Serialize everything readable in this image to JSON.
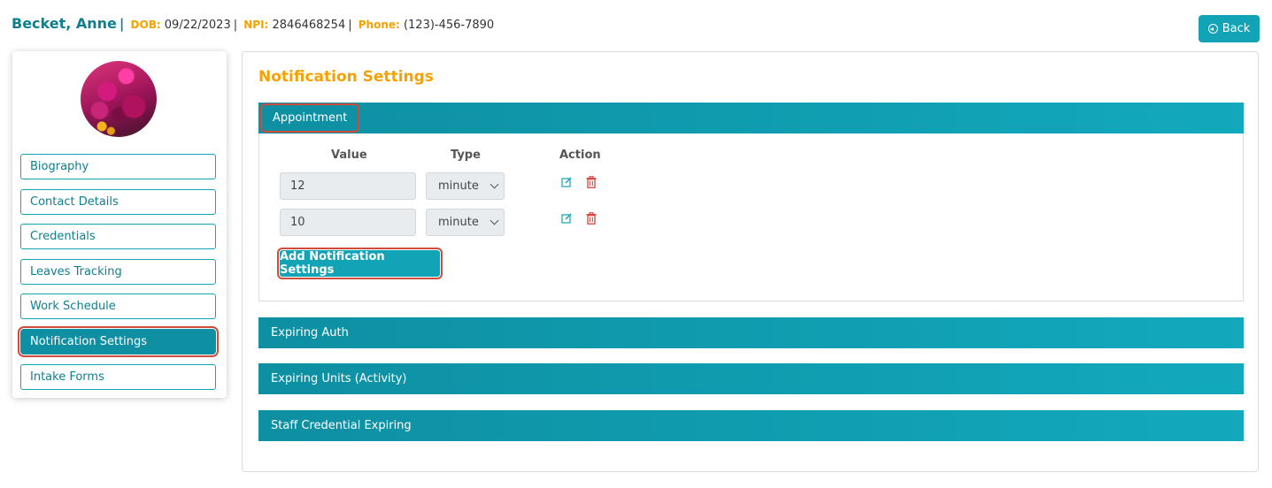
{
  "patient": {
    "name": "Becket, Anne",
    "dob_label": "DOB:",
    "dob": "09/22/2023",
    "npi_label": "NPI:",
    "npi": "2846468254",
    "phone_label": "Phone:",
    "phone": "(123)-456-7890"
  },
  "back_label": "Back",
  "sidebar": {
    "items": [
      {
        "label": "Biography"
      },
      {
        "label": "Contact Details"
      },
      {
        "label": "Credentials"
      },
      {
        "label": "Leaves Tracking"
      },
      {
        "label": "Work Schedule"
      },
      {
        "label": "Notification Settings"
      },
      {
        "label": "Intake Forms"
      }
    ],
    "active_index": 5
  },
  "main": {
    "title": "Notification Settings",
    "sections": [
      {
        "label": "Appointment"
      },
      {
        "label": "Expiring Auth"
      },
      {
        "label": "Expiring Units (Activity)"
      },
      {
        "label": "Staff Credential Expiring"
      }
    ],
    "table": {
      "headers": {
        "value": "Value",
        "type": "Type",
        "action": "Action"
      },
      "rows": [
        {
          "value": "12",
          "type": "minute"
        },
        {
          "value": "10",
          "type": "minute"
        }
      ]
    },
    "add_button_label": "Add Notification Settings"
  },
  "colors": {
    "accent": "#12a4b6",
    "accent_dark": "#0e8fa2",
    "title_orange": "#f5a100",
    "highlight_red": "#d14b3b",
    "delete_red": "#e0403a"
  },
  "icons": {
    "back": "circle-arrow-left-icon",
    "edit": "edit-icon",
    "delete": "trash-icon"
  }
}
